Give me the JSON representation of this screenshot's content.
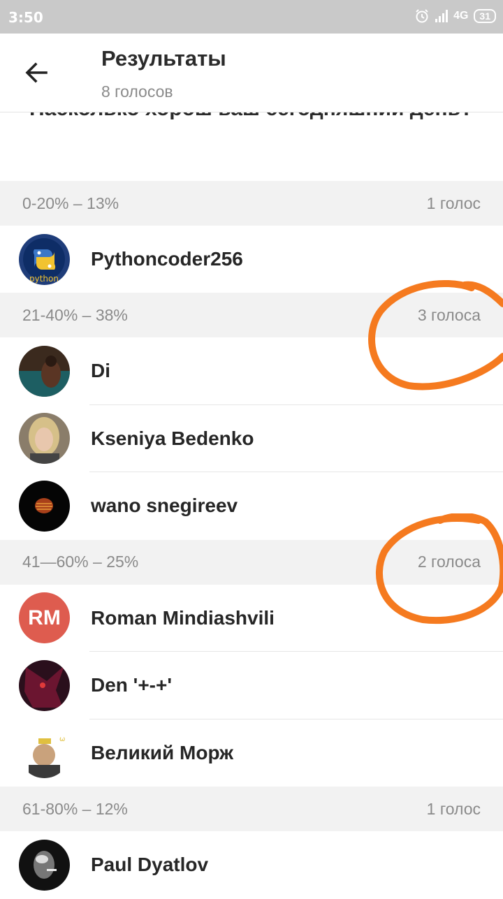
{
  "status_bar": {
    "time": "3:50",
    "network": "4G",
    "battery": "31"
  },
  "header": {
    "title": "Результаты",
    "subtitle": "8 голосов"
  },
  "question": {
    "text": "Насколько хорош ваш сегодняшний день?"
  },
  "sections": [
    {
      "range": "0-20% – 13%",
      "count": "1 голос",
      "voters": [
        {
          "name": "Pythoncoder256",
          "avatar_text": "python"
        }
      ]
    },
    {
      "range": "21-40% – 38%",
      "count": "3 голоса",
      "voters": [
        {
          "name": "Di"
        },
        {
          "name": "Kseniya Bedenko"
        },
        {
          "name": "wano snegireev"
        }
      ]
    },
    {
      "range": "41—60% – 25%",
      "count": "2 голоса",
      "voters": [
        {
          "name": "Roman Mindiashvili",
          "initials": "RM"
        },
        {
          "name": "Den '+-+'"
        },
        {
          "name": "Великий Морж"
        }
      ]
    },
    {
      "range": "61-80% – 12%",
      "count": "1 голос",
      "voters": [
        {
          "name": "Paul Dyatlov"
        }
      ]
    }
  ],
  "colors": {
    "annotation": "#f57a1f",
    "rm_avatar": "#de5c4f"
  }
}
